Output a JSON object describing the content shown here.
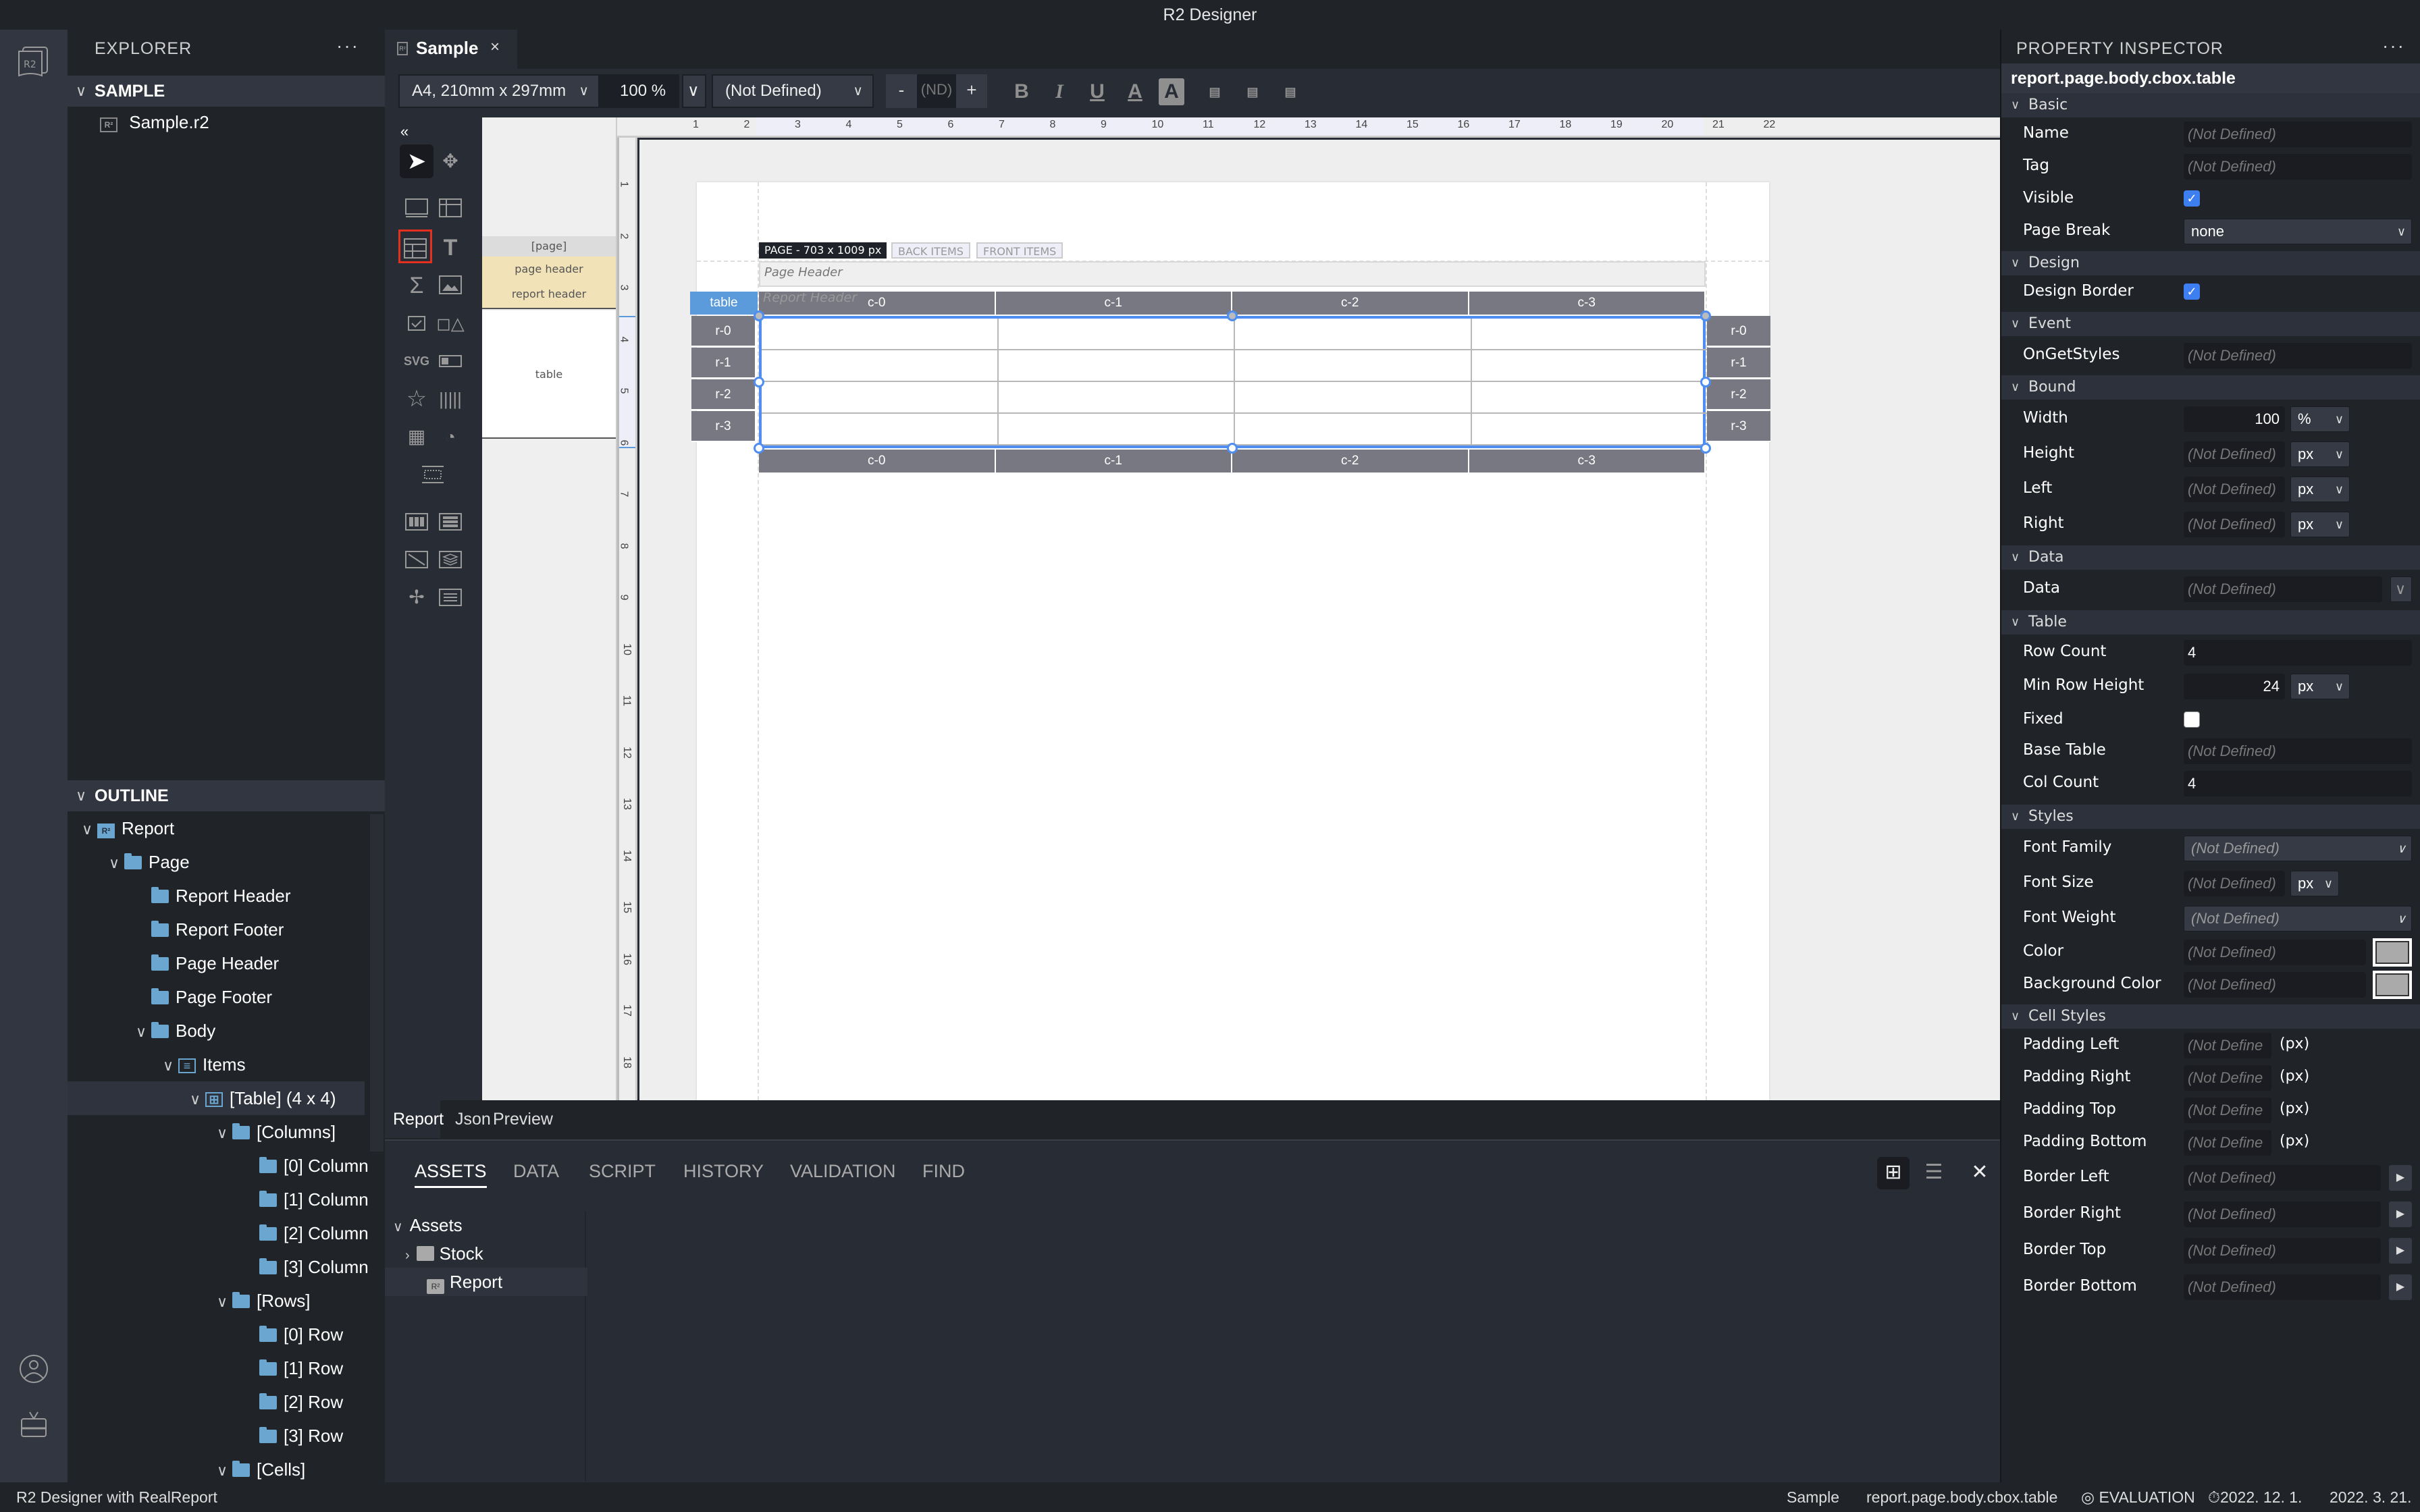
{
  "window": {
    "title": "R2 Designer"
  },
  "explorer": {
    "title": "EXPLORER",
    "more": "···",
    "project": "SAMPLE",
    "files": [
      {
        "name": "Sample.r2",
        "icon": "r2-file-icon"
      }
    ]
  },
  "outline": {
    "title": "OUTLINE",
    "items": [
      {
        "label": "Report",
        "depth": 0,
        "expanded": true,
        "icon": "report-icon"
      },
      {
        "label": "Page",
        "depth": 1,
        "expanded": true,
        "icon": "folder-icon"
      },
      {
        "label": "Report Header",
        "depth": 2,
        "icon": "folder-icon"
      },
      {
        "label": "Report Footer",
        "depth": 2,
        "icon": "folder-icon"
      },
      {
        "label": "Page Header",
        "depth": 2,
        "icon": "folder-icon"
      },
      {
        "label": "Page Footer",
        "depth": 2,
        "icon": "folder-icon"
      },
      {
        "label": "Body",
        "depth": 2,
        "expanded": true,
        "icon": "folder-icon"
      },
      {
        "label": "Items",
        "depth": 3,
        "expanded": true,
        "icon": "list-icon"
      },
      {
        "label": "[Table] (4 x 4)",
        "depth": 4,
        "expanded": true,
        "icon": "table-icon",
        "selected": true
      },
      {
        "label": "[Columns]",
        "depth": 5,
        "expanded": true,
        "icon": "folder-icon"
      },
      {
        "label": "[0] Column",
        "depth": 6,
        "icon": "folder-icon"
      },
      {
        "label": "[1] Column",
        "depth": 6,
        "icon": "folder-icon"
      },
      {
        "label": "[2] Column",
        "depth": 6,
        "icon": "folder-icon"
      },
      {
        "label": "[3] Column",
        "depth": 6,
        "icon": "folder-icon"
      },
      {
        "label": "[Rows]",
        "depth": 5,
        "expanded": true,
        "icon": "folder-icon"
      },
      {
        "label": "[0] Row",
        "depth": 6,
        "icon": "folder-icon"
      },
      {
        "label": "[1] Row",
        "depth": 6,
        "icon": "folder-icon"
      },
      {
        "label": "[2] Row",
        "depth": 6,
        "icon": "folder-icon"
      },
      {
        "label": "[3] Row",
        "depth": 6,
        "icon": "folder-icon"
      },
      {
        "label": "[Cells]",
        "depth": 5,
        "expanded": true,
        "icon": "folder-icon"
      }
    ]
  },
  "editor": {
    "tab": {
      "label": "Sample",
      "close": "×"
    },
    "toolbar": {
      "page_size": "A4, 210mm x 297mm",
      "zoom": "100 %",
      "font": "(Not Defined)",
      "minus": "-",
      "font_size": "(ND)",
      "plus": "+",
      "bold": "B",
      "italic": "I",
      "underline": "U",
      "font_color": "A",
      "bg_color": "A"
    },
    "collapse": "«",
    "bands": {
      "page": "[page]",
      "page_header": "page header",
      "report_header": "report header",
      "table": "table"
    },
    "ruler_h": [
      "1",
      "2",
      "3",
      "4",
      "5",
      "6",
      "7",
      "8",
      "9",
      "10",
      "11",
      "12",
      "13",
      "14",
      "15",
      "16",
      "17",
      "18",
      "19",
      "20",
      "21",
      "22"
    ],
    "ruler_v": [
      "1",
      "2",
      "3",
      "4",
      "5",
      "6",
      "7",
      "8",
      "9",
      "10",
      "11",
      "12",
      "13",
      "14",
      "15",
      "16",
      "17",
      "18"
    ],
    "page_info": "PAGE - 703 x 1009 px",
    "back_items": "BACK ITEMS",
    "front_items": "FRONT ITEMS",
    "page_header_label": "Page Header",
    "report_header_label": "Report Header",
    "table_tag": "table",
    "columns": [
      "c-0",
      "c-1",
      "c-2",
      "c-3"
    ],
    "rows": [
      "r-0",
      "r-1",
      "r-2",
      "r-3"
    ],
    "accent": "#4f8ef0"
  },
  "design_tabs": [
    "Report",
    "Json",
    "Preview"
  ],
  "bottom_panel": {
    "tabs": [
      "ASSETS",
      "DATA",
      "SCRIPT",
      "HISTORY",
      "VALIDATION",
      "FIND"
    ],
    "active_tab": "ASSETS",
    "tree": [
      {
        "label": "Assets",
        "expanded": true
      },
      {
        "label": "Stock",
        "expanded": false
      },
      {
        "label": "Report",
        "selected": true
      }
    ],
    "close": "✕"
  },
  "inspector": {
    "title": "PROPERTY INSPECTOR",
    "more": "···",
    "path": "report.page.body.cbox.table",
    "nd": "(Not Defined)",
    "nd_short": "(Not Define",
    "groups": {
      "basic": "Basic",
      "design": "Design",
      "event": "Event",
      "bound": "Bound",
      "data": "Data",
      "table": "Table",
      "styles": "Styles",
      "cell_styles": "Cell Styles"
    },
    "labels": {
      "name": "Name",
      "tag": "Tag",
      "visible": "Visible",
      "page_break": "Page Break",
      "design_border": "Design Border",
      "on_get_styles": "OnGetStyles",
      "width": "Width",
      "height": "Height",
      "left": "Left",
      "right": "Right",
      "data": "Data",
      "row_count": "Row Count",
      "min_row_height": "Min Row Height",
      "fixed": "Fixed",
      "base_table": "Base Table",
      "col_count": "Col Count",
      "font_family": "Font Family",
      "font_size": "Font Size",
      "font_weight": "Font Weight",
      "color": "Color",
      "background_color": "Background Color",
      "padding_left": "Padding Left",
      "padding_right": "Padding Right",
      "padding_top": "Padding Top",
      "padding_bottom": "Padding Bottom",
      "border_left": "Border Left",
      "border_right": "Border Right",
      "border_top": "Border Top",
      "border_bottom": "Border Bottom"
    },
    "values": {
      "visible": true,
      "page_break": "none",
      "design_border": true,
      "width": "100",
      "width_unit": "%",
      "height_unit": "px",
      "left_unit": "px",
      "right_unit": "px",
      "row_count": "4",
      "min_row_height": "24",
      "min_row_height_unit": "px",
      "fixed": false,
      "col_count": "4",
      "font_size_unit": "px",
      "px_suffix": "(px)"
    }
  },
  "status": {
    "app": "R2 Designer with RealReport",
    "doc": "Sample",
    "path": "report.page.body.cbox.table",
    "license": "EVALUATION",
    "expiry": "2022. 12. 1.",
    "date": "2022. 3. 21."
  }
}
